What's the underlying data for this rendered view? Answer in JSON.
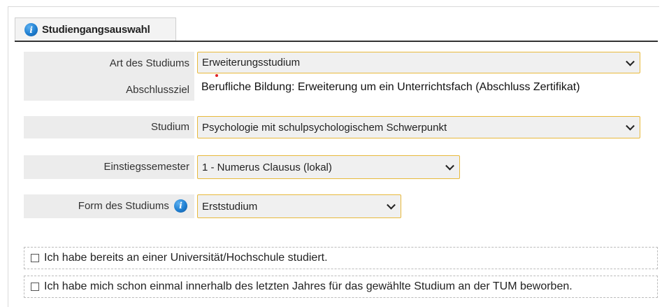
{
  "tab": {
    "title": "Studiengangsauswahl",
    "icon": "info-icon"
  },
  "fields": {
    "art": {
      "label": "Art des Studiums",
      "value": "Erweiterungsstudium"
    },
    "abschluss": {
      "label": "Abschlussziel",
      "value": "Berufliche Bildung: Erweiterung um ein Unterrichtsfach (Abschluss Zertifikat)"
    },
    "studium": {
      "label": "Studium",
      "value": "Psychologie mit schulpsychologischem Schwerpunkt"
    },
    "semester": {
      "label": "Einstiegssemester",
      "value": "1 - Numerus Clausus (lokal)"
    },
    "form": {
      "label": "Form des Studiums",
      "value": "Erststudium",
      "icon": "info-icon"
    }
  },
  "checkboxes": [
    {
      "label": "Ich habe bereits an einer Universität/Hochschule studiert.",
      "checked": false
    },
    {
      "label": "Ich habe mich schon einmal innerhalb des letzten Jahres für das gewählte Studium an der TUM beworben.",
      "checked": false
    }
  ],
  "colors": {
    "select_border": "#e8b93c",
    "label_bg": "#ececec",
    "info_icon": "#1f7fd1"
  }
}
